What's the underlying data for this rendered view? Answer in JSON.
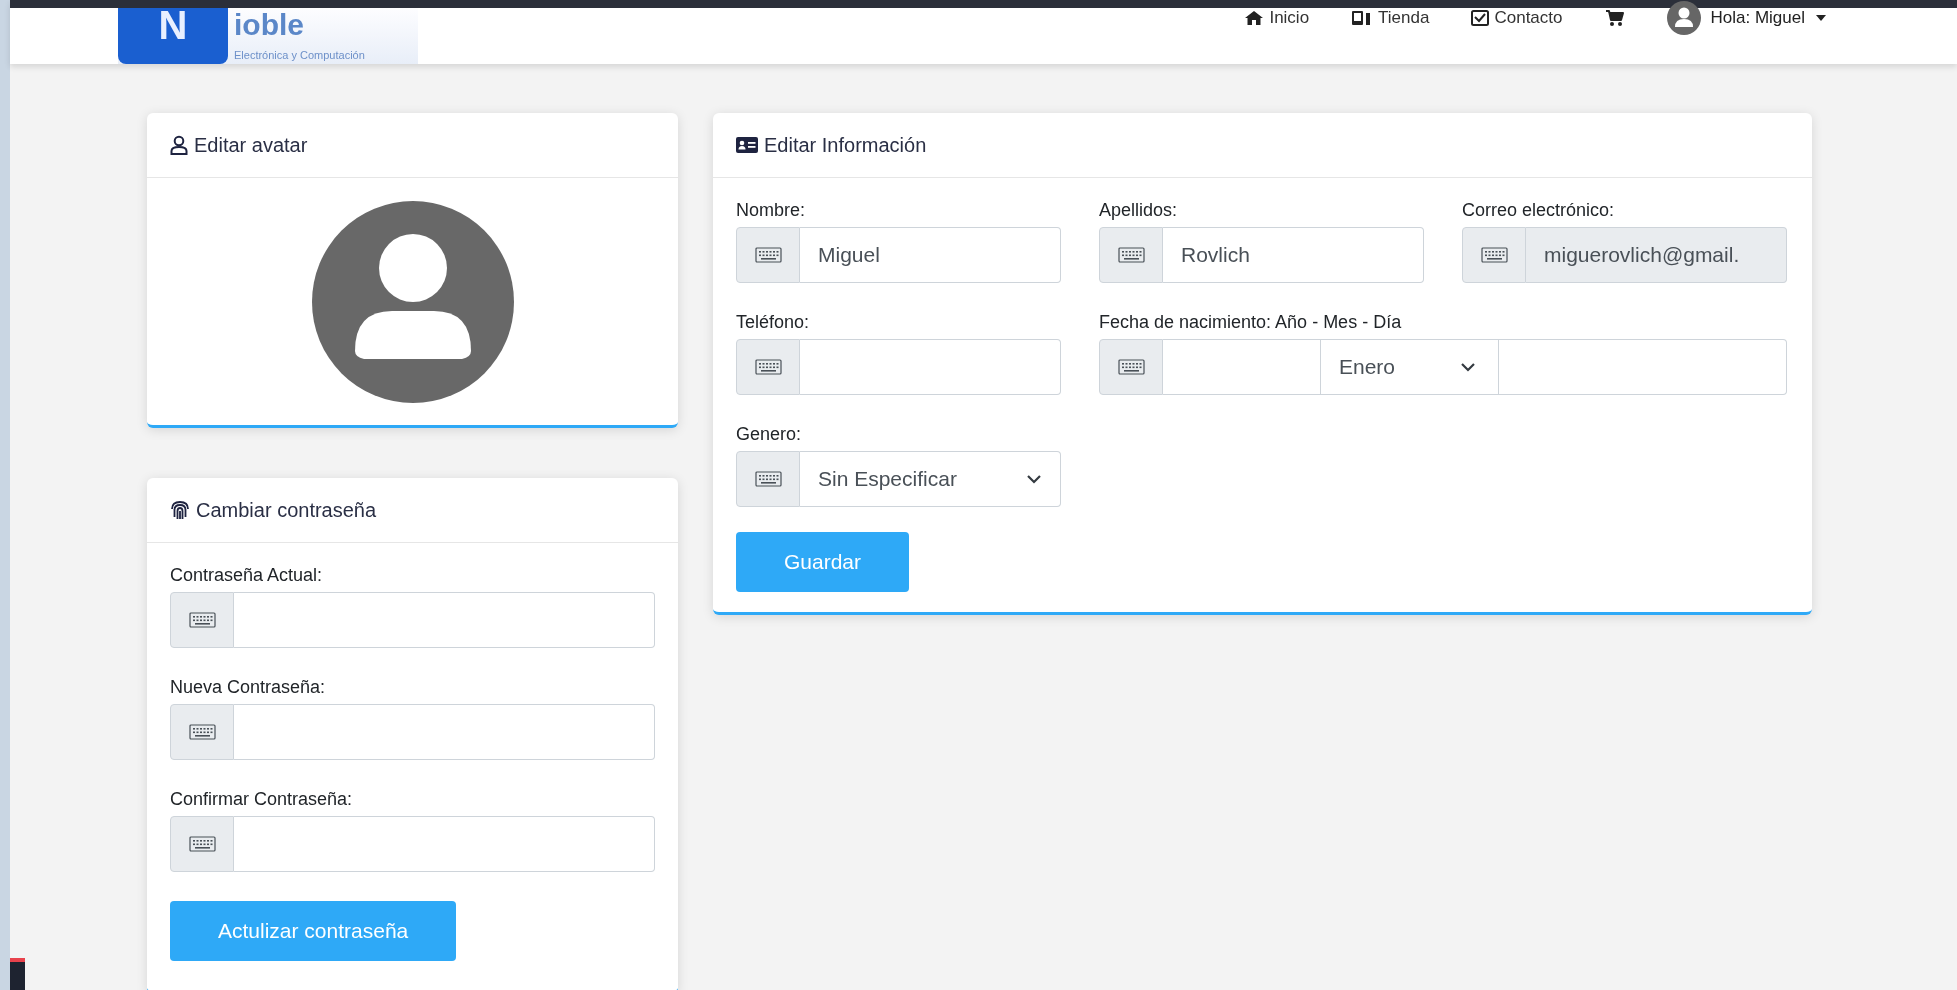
{
  "header": {
    "logo": {
      "initial": "N",
      "name": "ioble",
      "tagline": "Electrónica y Computación"
    },
    "nav": [
      {
        "kind": "link",
        "label": "Inicio"
      },
      {
        "kind": "link",
        "label": "Tienda"
      },
      {
        "kind": "link",
        "label": "Contacto"
      },
      {
        "kind": "cart"
      }
    ],
    "user_menu": {
      "greeting": "Hola: Miguel"
    }
  },
  "avatar_card": {
    "title": "Editar avatar"
  },
  "password_card": {
    "title": "Cambiar contraseña",
    "fields": [
      {
        "label": "Contraseña Actual:"
      },
      {
        "label": "Nueva Contraseña:"
      },
      {
        "label": "Confirmar Contraseña:"
      }
    ],
    "button": "Actulizar contraseña"
  },
  "info_card": {
    "title": "Editar Información",
    "fields": [
      {
        "kind": "text",
        "label": "Nombre:",
        "value": "Miguel",
        "disabled": false
      },
      {
        "kind": "text",
        "label": "Apellidos:",
        "value": "Rovlich",
        "disabled": false
      },
      {
        "kind": "text",
        "label": "Correo electrónico:",
        "value": "miguerovlich@gmail.",
        "disabled": true
      },
      {
        "kind": "text",
        "label": "Teléfono:",
        "disabled": false
      },
      {
        "kind": "date",
        "label": "Fecha de nacimiento: Año - Mes - Día",
        "month": "Enero",
        "disabled": false
      },
      {
        "kind": "select",
        "label": "Genero:",
        "value": "Sin Especificar",
        "disabled": false
      }
    ],
    "button": "Guardar"
  }
}
